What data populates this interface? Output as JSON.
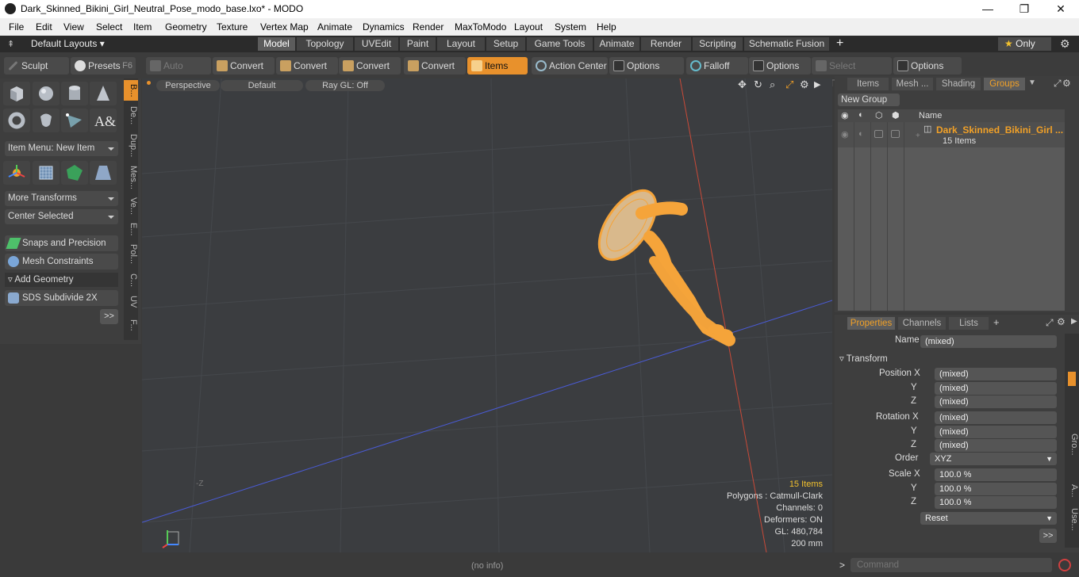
{
  "window": {
    "title": "Dark_Skinned_Bikini_Girl_Neutral_Pose_modo_base.lxo* - MODO",
    "minimize": "—",
    "maximize": "❐",
    "close": "✕"
  },
  "menu": [
    "File",
    "Edit",
    "View",
    "Select",
    "Item",
    "Geometry",
    "Texture",
    "Vertex Map",
    "Animate",
    "Dynamics",
    "Render",
    "MaxToModo",
    "Layout",
    "System",
    "Help"
  ],
  "layouts": {
    "label": "Default Layouts",
    "only_label": "Only"
  },
  "layout_tabs": [
    "Model",
    "Topology",
    "UVEdit",
    "Paint",
    "Layout",
    "Setup",
    "Game Tools",
    "Animate",
    "Render",
    "Scripting",
    "Schematic Fusion"
  ],
  "layout_active": "Model",
  "toolbar": {
    "sculpt": "Sculpt",
    "presets": "Presets",
    "presets_key": "F6",
    "auto_select": "Auto Select",
    "convert1": "Convert",
    "convert2": "Convert",
    "convert3": "Convert",
    "convert4": "Convert",
    "items": "Items",
    "action_center": "Action Center",
    "options1": "Options",
    "falloff": "Falloff",
    "options2": "Options",
    "select_through": "Select Through",
    "options3": "Options"
  },
  "left": {
    "item_menu": "Item Menu: New Item",
    "more_transforms": "More Transforms",
    "center_selected": "Center Selected",
    "snaps": "Snaps and Precision",
    "mesh_constraints": "Mesh Constraints",
    "add_geometry": "Add Geometry",
    "sds": "SDS Subdivide 2X",
    "more": ">>",
    "vtabs": [
      "B...",
      "De...",
      "Dup...",
      "Mes...",
      "Ve...",
      "E...",
      "Pol...",
      "C...",
      "UV",
      "F..."
    ]
  },
  "viewport": {
    "perspective": "Perspective",
    "default": "Default",
    "raygl": "Ray GL: Off",
    "axis_label": "-Z",
    "info": {
      "items": "15 Items",
      "polygons": "Polygons : Catmull-Clark",
      "channels": "Channels: 0",
      "deformers": "Deformers: ON",
      "gl": "GL: 480,784",
      "scale": "200 mm"
    }
  },
  "groups_panel": {
    "tabs": [
      "Items",
      "Mesh ...",
      "Shading",
      "Groups"
    ],
    "active": "Groups",
    "new_group": "New Group",
    "col_name": "Name",
    "group_name": "Dark_Skinned_Bikini_Girl ...",
    "group_count": "15 Items"
  },
  "properties": {
    "tabs": [
      "Properties",
      "Channels",
      "Lists"
    ],
    "name_label": "Name",
    "name_value": "(mixed)",
    "transform": "Transform",
    "position_x_label": "Position X",
    "y_label": "Y",
    "z_label": "Z",
    "pos": [
      "(mixed)",
      "(mixed)",
      "(mixed)"
    ],
    "rotation_x_label": "Rotation X",
    "rot": [
      "(mixed)",
      "(mixed)",
      "(mixed)"
    ],
    "order_label": "Order",
    "order_value": "XYZ",
    "scale_x_label": "Scale X",
    "scale": [
      "100.0 %",
      "100.0 %",
      "100.0 %"
    ],
    "reset": "Reset",
    "more": ">>",
    "side_tabs": [
      "Gro...",
      "A...",
      "Use..."
    ]
  },
  "status": {
    "info": "(no info)",
    "command_placeholder": "Command",
    "prompt": ">"
  },
  "colors": {
    "accent": "#f2a127",
    "items_button": "#e8912c",
    "mesh": "#f5a43a",
    "red_axis": "#c94a38",
    "blue_axis": "#4a5bd6"
  }
}
